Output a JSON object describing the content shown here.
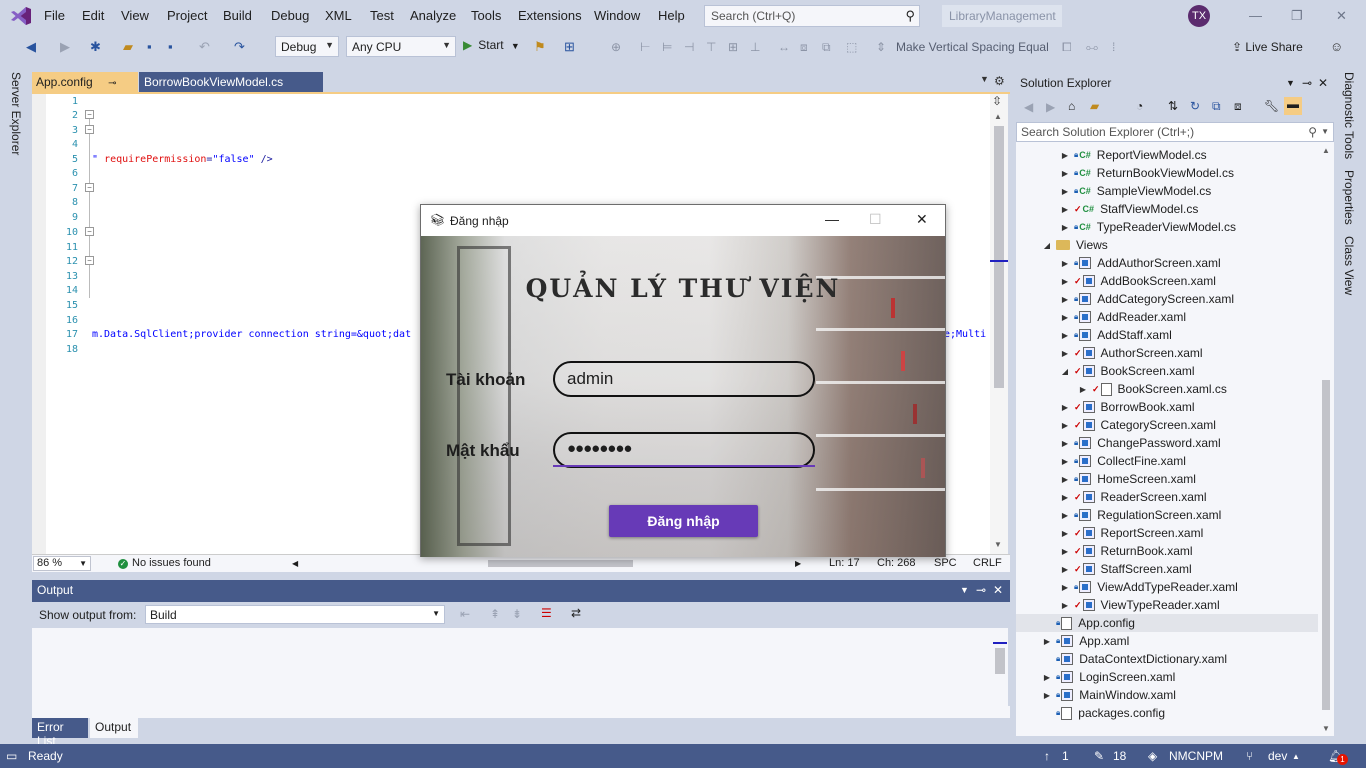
{
  "menubar": {
    "items": [
      "File",
      "Edit",
      "View",
      "Project",
      "Build",
      "Debug",
      "XML",
      "Test",
      "Analyze",
      "Tools",
      "Extensions",
      "Window",
      "Help"
    ],
    "search_placeholder": "Search (Ctrl+Q)",
    "solution_name": "LibraryManagement",
    "avatar_initials": "TX"
  },
  "toolbar": {
    "config": "Debug",
    "platform": "Any CPU",
    "start_label": "Start",
    "vspace_label": "Make Vertical Spacing Equal",
    "liveshare_label": "Live Share"
  },
  "left_strip": {
    "server_explorer": "Server Explorer"
  },
  "editor": {
    "tabs": [
      {
        "label": "App.config",
        "active": true
      },
      {
        "label": "BorrowBookViewModel.cs",
        "active": false
      }
    ],
    "lines": [
      "1",
      "2",
      "3",
      "4",
      "5",
      "6",
      "7",
      "8",
      "9",
      "10",
      "11",
      "12",
      "13",
      "14",
      "15",
      "16",
      "17",
      "18"
    ],
    "line5": {
      "prefix": "\"",
      "attr": "requirePermission",
      "eq": "=",
      "val": "\"false\"",
      "close": " />"
    },
    "line17_left": "m.Data.SqlClient;provider connection string=&quot;dat",
    "line17_right": "e;Multi",
    "status": {
      "zoom": "86 %",
      "issues": "No issues found",
      "ln": "Ln: 17",
      "ch": "Ch: 268",
      "spc": "SPC",
      "crlf": "CRLF"
    }
  },
  "output": {
    "title": "Output",
    "show_from_label": "Show output from:",
    "source": "Build",
    "tabs": [
      "Error List",
      "Output"
    ]
  },
  "solution_explorer": {
    "title": "Solution Explorer",
    "search_placeholder": "Search Solution Explorer (Ctrl+;)",
    "items": [
      {
        "label": "ReportViewModel.cs",
        "icon": "cs",
        "badge": "lock"
      },
      {
        "label": "ReturnBookViewModel.cs",
        "icon": "cs",
        "badge": "lock"
      },
      {
        "label": "SampleViewModel.cs",
        "icon": "cs",
        "badge": "lock"
      },
      {
        "label": "StaffViewModel.cs",
        "icon": "cs",
        "badge": "check"
      },
      {
        "label": "TypeReaderViewModel.cs",
        "icon": "cs",
        "badge": "lock"
      },
      {
        "label": "Views",
        "icon": "folder",
        "badge": ""
      },
      {
        "label": "AddAuthorScreen.xaml",
        "icon": "xaml",
        "badge": "lock"
      },
      {
        "label": "AddBookScreen.xaml",
        "icon": "xaml",
        "badge": "check"
      },
      {
        "label": "AddCategoryScreen.xaml",
        "icon": "xaml",
        "badge": "lock"
      },
      {
        "label": "AddReader.xaml",
        "icon": "xaml",
        "badge": "lock"
      },
      {
        "label": "AddStaff.xaml",
        "icon": "xaml",
        "badge": "lock"
      },
      {
        "label": "AuthorScreen.xaml",
        "icon": "xaml",
        "badge": "check"
      },
      {
        "label": "BookScreen.xaml",
        "icon": "xaml",
        "badge": "check"
      },
      {
        "label": "BookScreen.xaml.cs",
        "icon": "file",
        "badge": "check"
      },
      {
        "label": "BorrowBook.xaml",
        "icon": "xaml",
        "badge": "check"
      },
      {
        "label": "CategoryScreen.xaml",
        "icon": "xaml",
        "badge": "check"
      },
      {
        "label": "ChangePassword.xaml",
        "icon": "xaml",
        "badge": "lock"
      },
      {
        "label": "CollectFine.xaml",
        "icon": "xaml",
        "badge": "lock"
      },
      {
        "label": "HomeScreen.xaml",
        "icon": "xaml",
        "badge": "lock"
      },
      {
        "label": "ReaderScreen.xaml",
        "icon": "xaml",
        "badge": "check"
      },
      {
        "label": "RegulationScreen.xaml",
        "icon": "xaml",
        "badge": "lock"
      },
      {
        "label": "ReportScreen.xaml",
        "icon": "xaml",
        "badge": "check"
      },
      {
        "label": "ReturnBook.xaml",
        "icon": "xaml",
        "badge": "check"
      },
      {
        "label": "StaffScreen.xaml",
        "icon": "xaml",
        "badge": "check"
      },
      {
        "label": "ViewAddTypeReader.xaml",
        "icon": "xaml",
        "badge": "lock"
      },
      {
        "label": "ViewTypeReader.xaml",
        "icon": "xaml",
        "badge": "check"
      },
      {
        "label": "App.config",
        "icon": "file",
        "badge": "lock"
      },
      {
        "label": "App.xaml",
        "icon": "xaml",
        "badge": "lock"
      },
      {
        "label": "DataContextDictionary.xaml",
        "icon": "xaml",
        "badge": "lock"
      },
      {
        "label": "LoginScreen.xaml",
        "icon": "xaml",
        "badge": "lock"
      },
      {
        "label": "MainWindow.xaml",
        "icon": "xaml",
        "badge": "lock"
      },
      {
        "label": "packages.config",
        "icon": "file",
        "badge": "lock"
      }
    ]
  },
  "right_strip": [
    "Diagnostic Tools",
    "Properties",
    "Class View"
  ],
  "statusbar": {
    "ready": "Ready",
    "up_count": "1",
    "edit_count": "18",
    "repo": "NMCNPM",
    "branch": "dev",
    "notifications": "1"
  },
  "login": {
    "window_title": "Đăng nhập",
    "heading": "QUẢN LÝ THƯ VIỆN",
    "username_label": "Tài khoản",
    "username_value": "admin",
    "password_label": "Mật khẩu",
    "password_value": "●●●●●●●●",
    "button_label": "Đăng nhập"
  },
  "colors": {
    "accent": "#673ab7",
    "tab_active": "#f5cc84",
    "statusbar": "#465a8a"
  }
}
